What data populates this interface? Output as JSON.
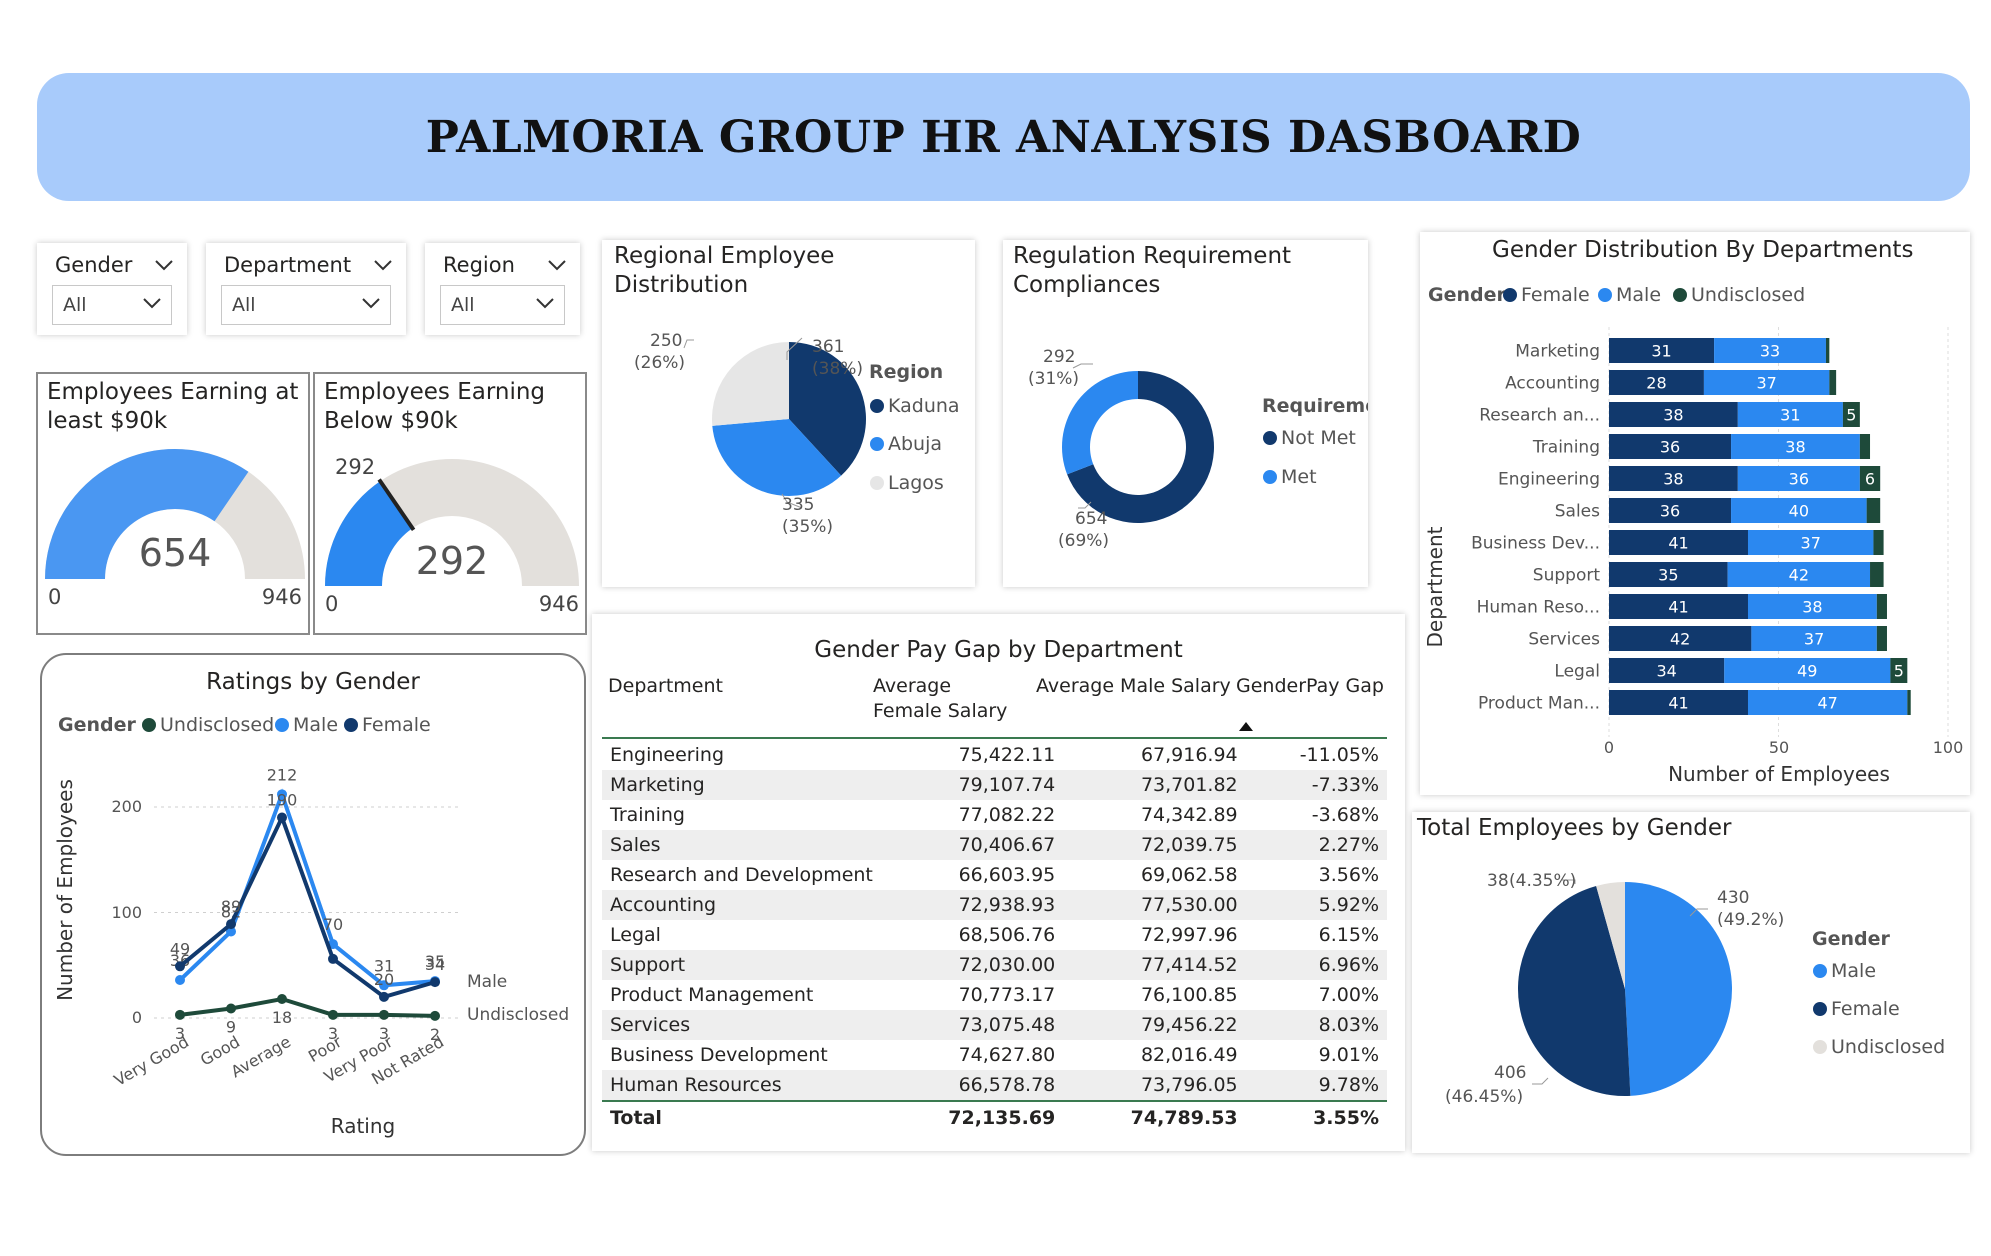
{
  "header": {
    "title": "PALMORIA GROUP HR ANALYSIS DASBOARD"
  },
  "colors": {
    "banner": "#a8cbfb",
    "navy": "#11396d",
    "blue": "#2b88f0",
    "green": "#1e4a3a",
    "grey": "#e3e0dc",
    "light_grey": "#e6e6e6"
  },
  "slicers": [
    {
      "label": "Gender",
      "value": "All"
    },
    {
      "label": "Department",
      "value": "All"
    },
    {
      "label": "Region",
      "value": "All"
    }
  ],
  "kpi": [
    {
      "title_line1": "Employees Earning at",
      "title_line2": "least $90k",
      "value": "654",
      "min": "0",
      "max": "946",
      "fill_fraction": 0.691
    },
    {
      "title_line1": "Employees Earning",
      "title_line2": "Below $90k",
      "value": "292",
      "target": "292",
      "min": "0",
      "max": "946",
      "fill_fraction": 0.309
    }
  ],
  "regional": {
    "title": "Regional Employee Distribution",
    "legend_title": "Region",
    "labels": [
      {
        "count": "361",
        "pct": "(38%)"
      },
      {
        "count": "335",
        "pct": "(35%)"
      },
      {
        "count": "250",
        "pct": "(26%)"
      }
    ],
    "chart_data": {
      "type": "pie",
      "title": "Regional Employee Distribution",
      "categories": [
        "Kaduna",
        "Abuja",
        "Lagos"
      ],
      "values": [
        361,
        335,
        250
      ],
      "colors": [
        "#11396d",
        "#2b88f0",
        "#e6e6e6"
      ]
    }
  },
  "compliance": {
    "title_line1": "Regulation Requirement",
    "title_line2": "Compliances",
    "legend_title": "Requirement",
    "labels": [
      {
        "count": "654",
        "pct": "(69%)"
      },
      {
        "count": "292",
        "pct": "(31%)"
      }
    ],
    "chart_data": {
      "type": "pie",
      "title": "Regulation Requirement Compliances",
      "categories": [
        "Not Met",
        "Met"
      ],
      "values": [
        654,
        292
      ],
      "colors": [
        "#11396d",
        "#2b88f0"
      ]
    }
  },
  "gender_dept": {
    "title": "Gender Distribution By Departments",
    "legend_title": "Gender",
    "legend": [
      "Female",
      "Male",
      "Undisclosed"
    ],
    "xlabel": "Number of Employees",
    "ylabel": "Department",
    "ticks": [
      "0",
      "50",
      "100"
    ],
    "chart_data": {
      "type": "bar",
      "orientation": "horizontal-stacked",
      "categories": [
        "Marketing",
        "Accounting",
        "Research an...",
        "Training",
        "Engineering",
        "Sales",
        "Business Dev...",
        "Support",
        "Human Reso...",
        "Services",
        "Legal",
        "Product Man..."
      ],
      "series": [
        {
          "name": "Female",
          "values": [
            31,
            28,
            38,
            36,
            38,
            36,
            41,
            35,
            41,
            42,
            34,
            41
          ]
        },
        {
          "name": "Male",
          "values": [
            33,
            37,
            31,
            38,
            36,
            40,
            37,
            42,
            38,
            37,
            49,
            47
          ]
        },
        {
          "name": "Undisclosed",
          "values": [
            1,
            2,
            5,
            3,
            6,
            4,
            3,
            4,
            3,
            3,
            5,
            1
          ]
        }
      ],
      "xlim": [
        0,
        100
      ],
      "xlabel": "Number of Employees",
      "ylabel": "Department"
    }
  },
  "ratings": {
    "title": "Ratings by Gender",
    "legend_title": "Gender",
    "legend": [
      "Undisclosed",
      "Male",
      "Female"
    ],
    "xlabel": "Rating",
    "ylabel": "Number of Employees",
    "yticks": [
      "0",
      "100",
      "200"
    ],
    "end_labels": [
      "Male",
      "Undisclosed"
    ],
    "chart_data": {
      "type": "line",
      "categories": [
        "Very Good",
        "Good",
        "Average",
        "Poor",
        "Very Poor",
        "Not Rated"
      ],
      "series": [
        {
          "name": "Undisclosed",
          "values": [
            3,
            9,
            18,
            3,
            3,
            2
          ]
        },
        {
          "name": "Male",
          "values": [
            36,
            82,
            212,
            70,
            31,
            35
          ]
        },
        {
          "name": "Female",
          "values": [
            49,
            89,
            190,
            56,
            20,
            34
          ]
        }
      ],
      "data_labels": {
        "Undisclosed": [
          "3",
          "9",
          "18",
          "3",
          "3",
          "2"
        ],
        "Male": [
          "36",
          "82",
          "212",
          "70",
          "31",
          "35"
        ],
        "Female": [
          "49",
          "89",
          "190",
          "",
          "20",
          "34"
        ]
      },
      "ylim": [
        0,
        240
      ],
      "xlabel": "Rating",
      "ylabel": "Number of Employees"
    }
  },
  "paygap": {
    "title": "Gender Pay Gap by Department",
    "columns": [
      "Department",
      "Average Female Salary",
      "Average Male Salary",
      "GenderPay Gap"
    ],
    "rows": [
      [
        "Engineering",
        "75,422.11",
        "67,916.94",
        "-11.05%"
      ],
      [
        "Marketing",
        "79,107.74",
        "73,701.82",
        "-7.33%"
      ],
      [
        "Training",
        "77,082.22",
        "74,342.89",
        "-3.68%"
      ],
      [
        "Sales",
        "70,406.67",
        "72,039.75",
        "2.27%"
      ],
      [
        "Research and Development",
        "66,603.95",
        "69,062.58",
        "3.56%"
      ],
      [
        "Accounting",
        "72,938.93",
        "77,530.00",
        "5.92%"
      ],
      [
        "Legal",
        "68,506.76",
        "72,997.96",
        "6.15%"
      ],
      [
        "Support",
        "72,030.00",
        "77,414.52",
        "6.96%"
      ],
      [
        "Product Management",
        "70,773.17",
        "76,100.85",
        "7.00%"
      ],
      [
        "Services",
        "73,075.48",
        "79,456.22",
        "8.03%"
      ],
      [
        "Business Development",
        "74,627.80",
        "82,016.49",
        "9.01%"
      ],
      [
        "Human Resources",
        "66,578.78",
        "73,796.05",
        "9.78%"
      ]
    ],
    "total": [
      "Total",
      "72,135.69",
      "74,789.53",
      "3.55%"
    ]
  },
  "total_gender": {
    "title": "Total Employees by Gender",
    "legend_title": "Gender",
    "labels": [
      {
        "count": "430",
        "pct": "(49.2%)"
      },
      {
        "count": "406",
        "pct": "(46.45%)"
      },
      {
        "count": "38",
        "pct": "(4.35%)"
      }
    ],
    "chart_data": {
      "type": "pie",
      "title": "Total Employees by Gender",
      "categories": [
        "Male",
        "Female",
        "Undisclosed"
      ],
      "values": [
        430,
        406,
        38
      ],
      "colors": [
        "#2b88f0",
        "#11396d",
        "#e3e0dc"
      ]
    }
  }
}
